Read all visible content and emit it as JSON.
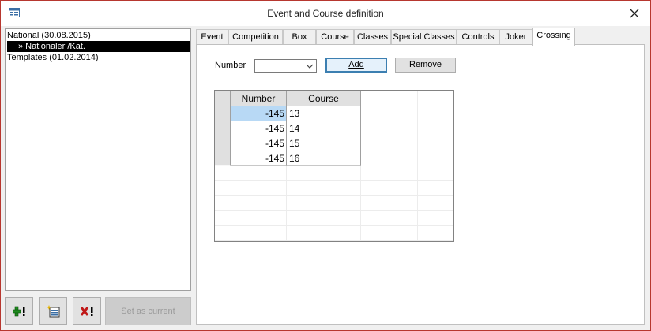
{
  "window": {
    "title": "Event and Course definition"
  },
  "tree": {
    "items": [
      {
        "label": "National (30.08.2015)"
      },
      {
        "label": "» Nationaler /Kat."
      },
      {
        "label": "Templates (01.02.2014)"
      }
    ]
  },
  "left_buttons": {
    "add_icon": "green-plus-exclamation-icon",
    "list_icon": "new-record-list-icon",
    "delete_icon": "red-x-exclamation-icon",
    "set_current_label": "Set as current"
  },
  "tabs": [
    {
      "label": "Event"
    },
    {
      "label": "Competition"
    },
    {
      "label": "Box"
    },
    {
      "label": "Course"
    },
    {
      "label": "Classes"
    },
    {
      "label": "Special Classes"
    },
    {
      "label": "Controls"
    },
    {
      "label": "Joker"
    },
    {
      "label": "Crossing"
    }
  ],
  "crossing": {
    "number_label": "Number",
    "number_value": "",
    "add_label": "Add",
    "remove_label": "Remove",
    "table": {
      "headers": [
        "Number",
        "Course"
      ],
      "rows": [
        {
          "number": "-145",
          "course": "13"
        },
        {
          "number": "-145",
          "course": "14"
        },
        {
          "number": "-145",
          "course": "15"
        },
        {
          "number": "-145",
          "course": "16"
        }
      ]
    }
  },
  "colors": {
    "accent": "#3c7fb1",
    "selection": "#b8d9f5",
    "window_border": "#b7372f"
  }
}
